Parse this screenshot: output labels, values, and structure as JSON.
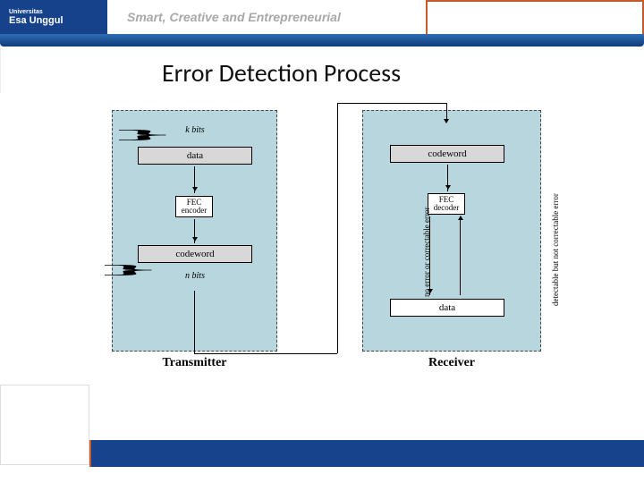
{
  "header": {
    "uni_small": "Universitas",
    "uni": "Esa Unggul",
    "tagline": "Smart, Creative and Entrepreneurial"
  },
  "title": "Error Detection Process",
  "diagram": {
    "transmitter_label": "Transmitter",
    "receiver_label": "Receiver",
    "k_bits": "k bits",
    "n_bits": "n bits",
    "data": "data",
    "fec_encoder": "FEC\nencoder",
    "fec_decoder": "FEC\ndecoder",
    "codeword": "codeword",
    "rx_caption_left": "no error or correctable error",
    "rx_caption_right": "detectable but not correctable error"
  }
}
